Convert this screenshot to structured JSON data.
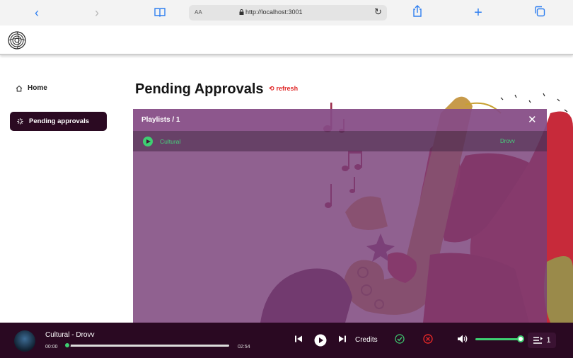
{
  "browser": {
    "back_icon": "chevron-left-icon",
    "forward_icon": "chevron-right-icon",
    "bookmarks_icon": "book-icon",
    "text_size_label": "AA",
    "url": "http://localhost:3001",
    "reload_icon": "reload-icon",
    "share_icon": "share-icon",
    "new_tab_icon": "plus-icon",
    "tabs_icon": "tabs-icon"
  },
  "sidebar": {
    "items": [
      {
        "label": "Home",
        "icon": "home-icon"
      },
      {
        "label": "Pending approvals",
        "icon": "spinner-icon",
        "active": true
      }
    ]
  },
  "main": {
    "title": "Pending Approvals",
    "refresh_label": "refresh"
  },
  "panel": {
    "title": "Playlists / 1",
    "rows": [
      {
        "name": "Cultural",
        "artist": "Drovv"
      }
    ]
  },
  "player": {
    "track": "Cultural - Drovv",
    "time_current": "00:00",
    "time_total": "02:54",
    "progress": 0.0,
    "credits_label": "Credits",
    "volume": 0.95,
    "queue_count": "1"
  },
  "colors": {
    "accent_green": "#3ecf72",
    "dark_purple": "#2a0922",
    "refresh_red": "#e02727",
    "browser_blue": "#2f7ff0"
  }
}
